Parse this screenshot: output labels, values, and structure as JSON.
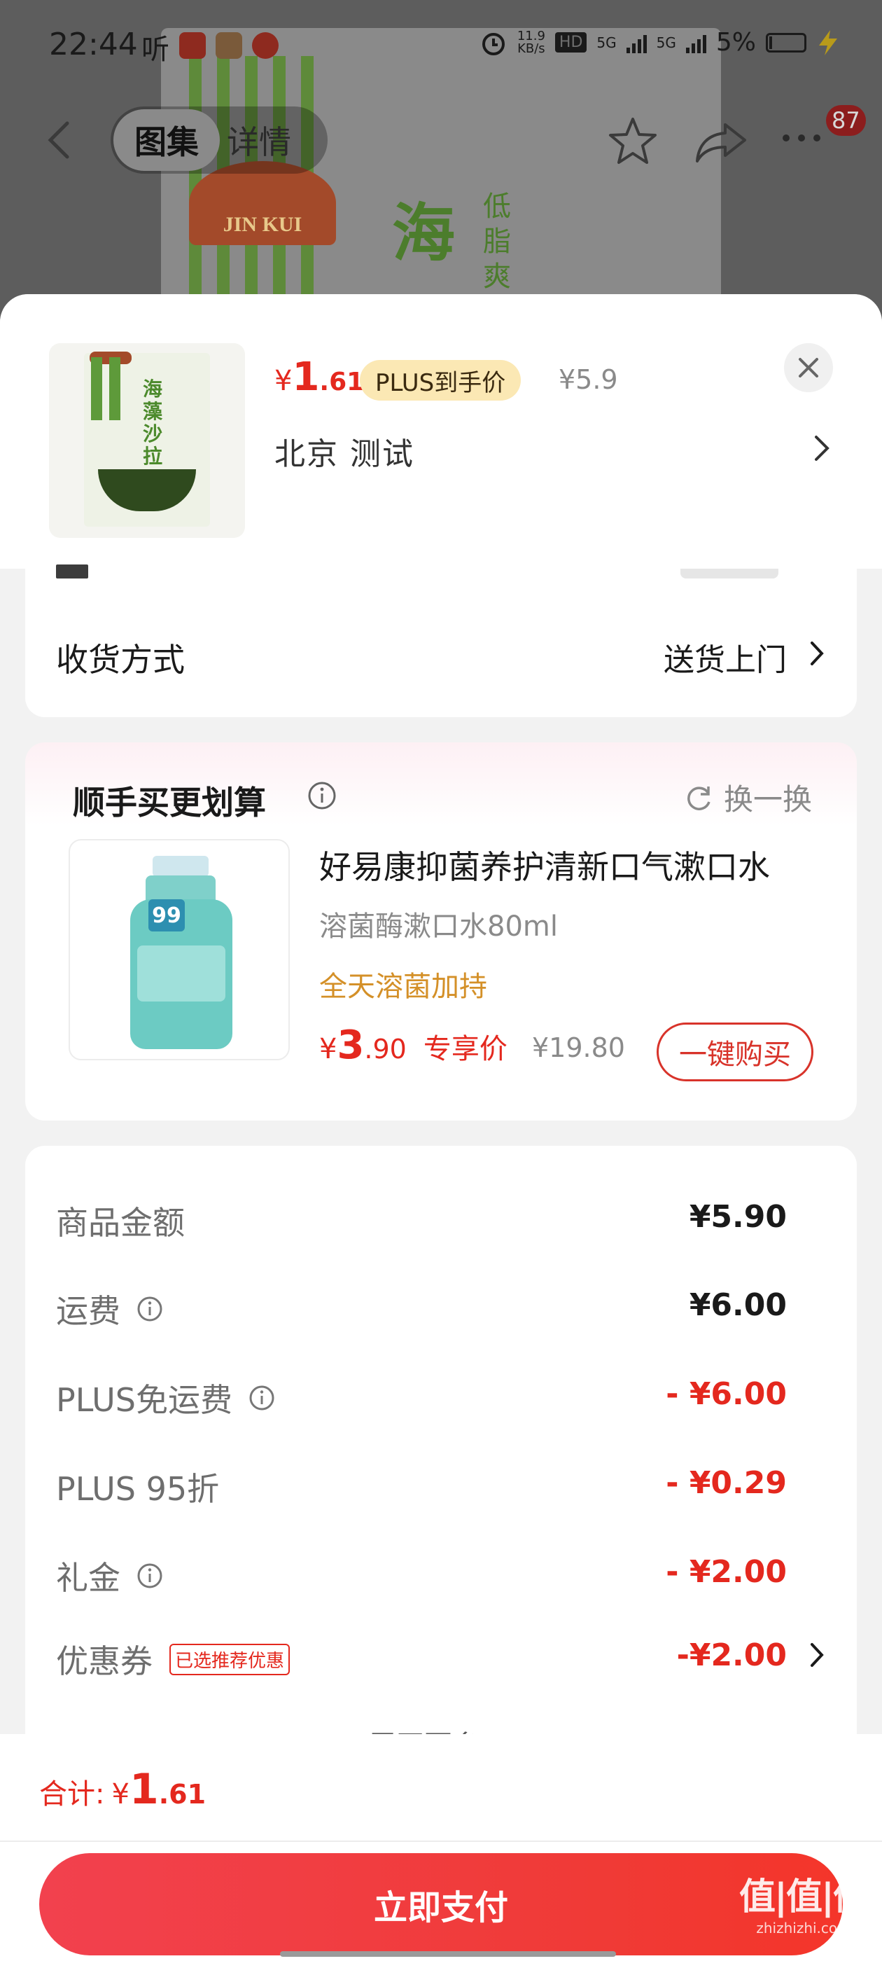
{
  "status_bar": {
    "time": "22:44",
    "ting": "听",
    "speed": "11.9",
    "speed_unit": "KB/s",
    "hd": "HD",
    "network1": "5G",
    "network2": "5G",
    "battery": "5%"
  },
  "nav": {
    "tab_gallery": "图集",
    "tab_detail": "详情",
    "badge_count": "87"
  },
  "backdrop": {
    "brand": "JIN KUI",
    "big_char": "海",
    "side_chars": "低脂爽"
  },
  "product": {
    "price_yen": "¥",
    "price_int": "1",
    "price_dec": ".61",
    "plus_tag": "PLUS到手价",
    "original_price": "¥5.9",
    "address": "北京  测试",
    "thumb_title": "海藻沙拉"
  },
  "delivery": {
    "label": "收货方式",
    "value": "送货上门"
  },
  "promo": {
    "title": "顺手买更划算",
    "refresh_label": "换一换",
    "name": "好易康抑菌养护清新口气漱口水",
    "subtitle": "溶菌酶漱口水80ml",
    "tagline": "全天溶菌加持",
    "price_yen": "¥",
    "price_int": "3",
    "price_dec": ".90",
    "exclusive_label": "专享价",
    "original_price": "¥19.80",
    "buy_label": "一键购买",
    "bottle_badge": "99"
  },
  "summary": {
    "rows": [
      {
        "label": "商品金额",
        "value": "¥5.90"
      },
      {
        "label": "运费",
        "value": "¥6.00"
      },
      {
        "label": "PLUS免运费",
        "value": "- ¥6.00"
      },
      {
        "label": "PLUS 95折",
        "value": "- ¥0.29"
      },
      {
        "label": "礼金",
        "value": "- ¥2.00"
      },
      {
        "label": "优惠券",
        "value": "-¥2.00",
        "tag": "已选推荐优惠"
      }
    ],
    "expand_more": "展开更多 ⌄"
  },
  "bottom": {
    "total_label": "合计:",
    "total_yen": "¥",
    "total_int": "1",
    "total_dec": ".61",
    "pay_label": "立即支付",
    "watermark": "值|值|值",
    "watermark_sub": "zhizhizhi.com"
  },
  "colors": {
    "accent_red": "#e4281e",
    "plus_tag_bg": "#fbe8b4",
    "tagline_orange": "#d49028"
  }
}
